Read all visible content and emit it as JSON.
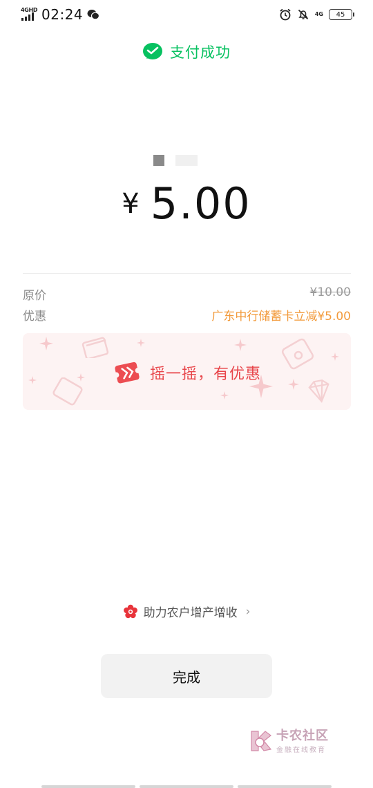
{
  "status_bar": {
    "network_label": "4GHD",
    "time": "02:24",
    "network_label_right": "4G",
    "battery": "45"
  },
  "header": {
    "title": "支付成功",
    "icon": "wechat-pay-icon",
    "accent_color": "#07c160"
  },
  "payment": {
    "currency_symbol": "¥",
    "amount": "5.00"
  },
  "details": {
    "original_price_label": "原价",
    "original_price_value": "¥10.00",
    "discount_label": "优惠",
    "discount_value": "广东中行储蓄卡立减¥5.00",
    "discount_color": "#f29a3b"
  },
  "promo_banner": {
    "text": "摇一摇，有优惠",
    "icon": "shake-ticket-icon",
    "color": "#e8454a"
  },
  "help_link": {
    "text": "助力农户增产增收",
    "icon": "red-flower-icon"
  },
  "done_button": {
    "label": "完成"
  },
  "watermark": {
    "title": "卡农社区",
    "subtitle": "金融在线教育"
  }
}
